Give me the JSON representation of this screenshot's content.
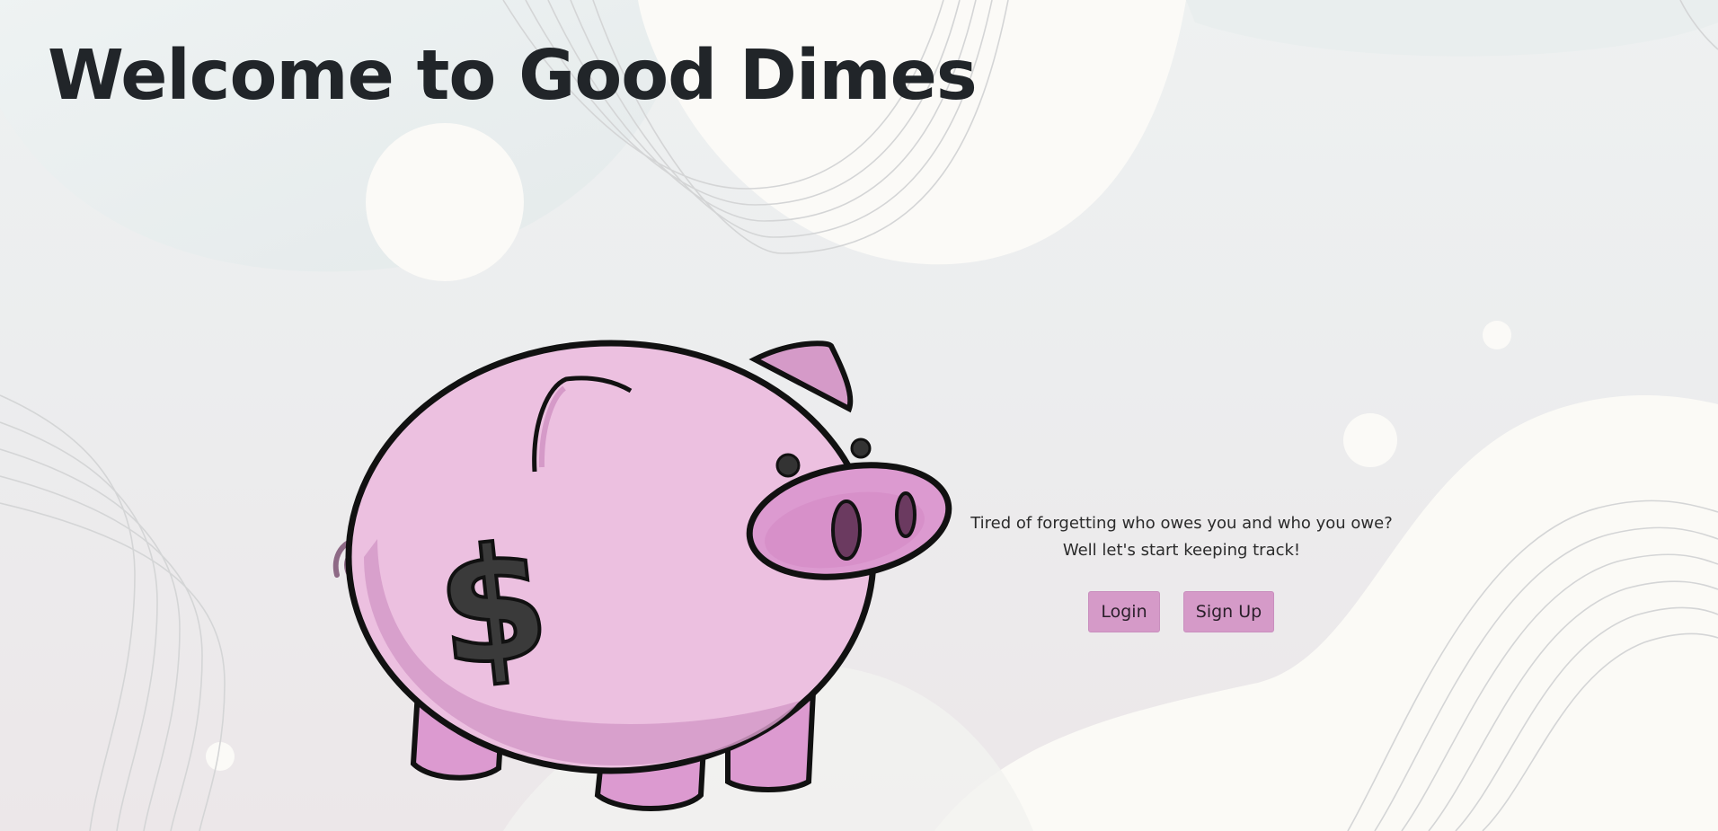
{
  "hero": {
    "title": "Welcome to Good Dimes",
    "tagline_line1": "Tired of forgetting who owes you and who you owe?",
    "tagline_line2": "Well let's start keeping track!"
  },
  "actions": {
    "login_label": "Login",
    "signup_label": "Sign Up"
  },
  "theme": {
    "accent": "#d59ac8",
    "pig_body": "#ecc0e0",
    "pig_shadow": "#d59ac8",
    "text": "#212529"
  },
  "illustration": {
    "icon": "piggy-bank-icon",
    "symbol": "$"
  }
}
